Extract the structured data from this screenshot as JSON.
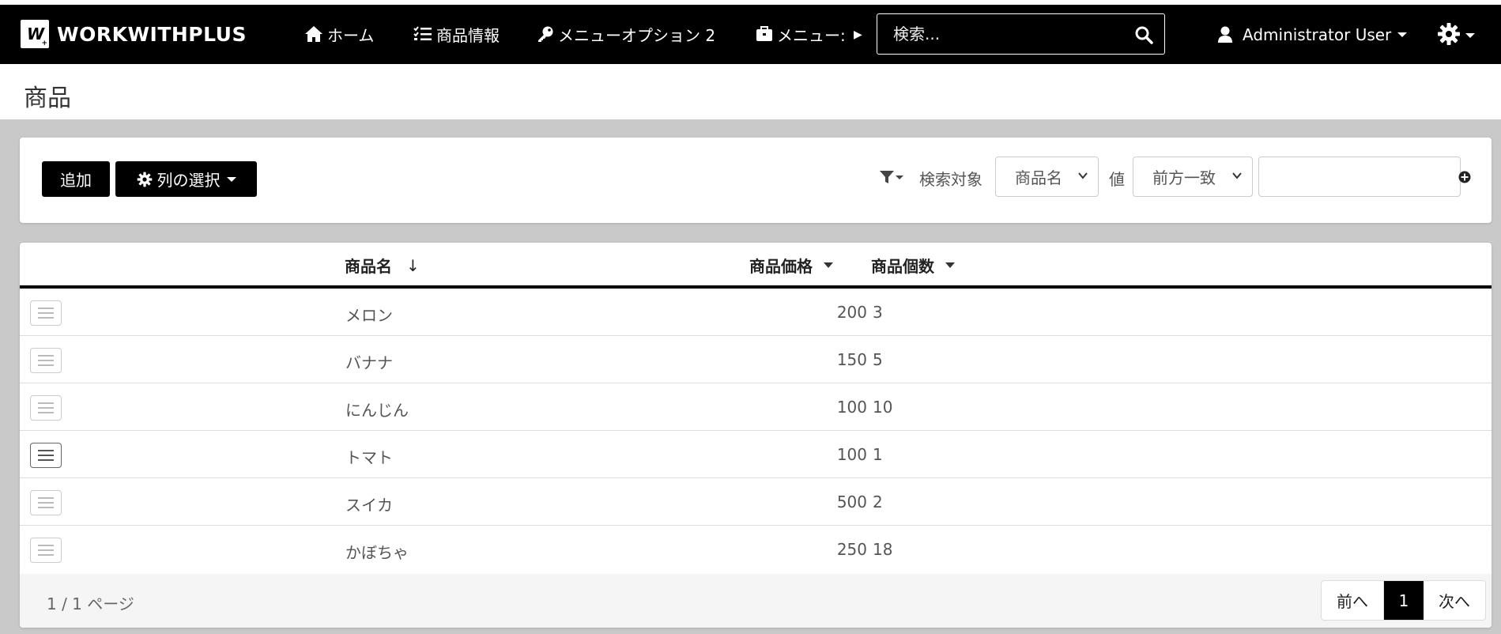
{
  "navbar": {
    "brand": "WORKWITHPLUS",
    "brand_logo": "W",
    "items": [
      {
        "label": "ホーム",
        "icon": "home-icon"
      },
      {
        "label": "商品情報",
        "icon": "checklist-icon"
      },
      {
        "label": "メニューオプション 2",
        "icon": "key-icon"
      },
      {
        "label": "メニュー:",
        "icon": "briefcase-icon"
      }
    ],
    "more_glyph": "▶",
    "search_placeholder": "検索...",
    "user": "Administrator User"
  },
  "page": {
    "title": "商品"
  },
  "toolbar": {
    "add_label": "追加",
    "columns_label": "列の選択",
    "search_target_label": "検索対象",
    "search_target_value": "商品名",
    "value_label": "値",
    "match_value": "前方一致"
  },
  "grid": {
    "columns": {
      "name": "商品名",
      "name_sort": "↓",
      "price": "商品価格",
      "qty": "商品個数"
    },
    "rows": [
      {
        "name": "メロン",
        "price": "200",
        "qty": "3"
      },
      {
        "name": "バナナ",
        "price": "150",
        "qty": "5"
      },
      {
        "name": "にんじん",
        "price": "100",
        "qty": "10"
      },
      {
        "name": "トマト",
        "price": "100",
        "qty": "1"
      },
      {
        "name": "スイカ",
        "price": "500",
        "qty": "2"
      },
      {
        "name": "かぼちゃ",
        "price": "250",
        "qty": "18"
      }
    ],
    "page_info": "1 / 1 ページ",
    "prev_label": "前へ",
    "current_page": "1",
    "next_label": "次へ"
  },
  "colors": {
    "navbar_bg": "#000000",
    "page_bg": "#c9c9c9",
    "accent": "#000000"
  }
}
